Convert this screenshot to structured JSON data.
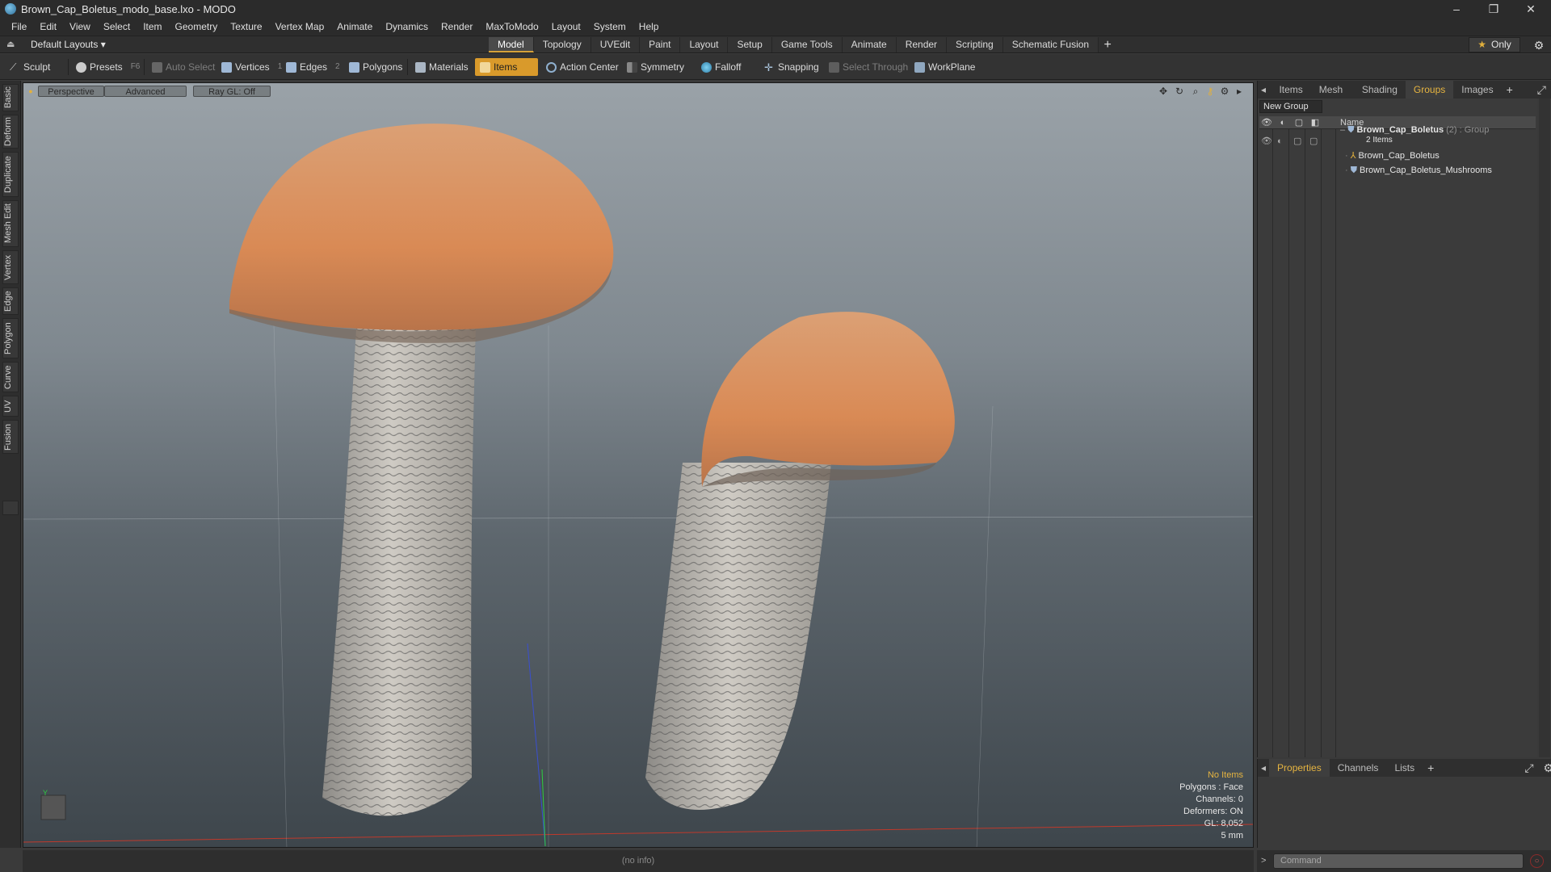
{
  "window": {
    "title": "Brown_Cap_Boletus_modo_base.lxo - MODO",
    "minimize": "–",
    "maximize": "❐",
    "close": "✕"
  },
  "menu": [
    "File",
    "Edit",
    "View",
    "Select",
    "Item",
    "Geometry",
    "Texture",
    "Vertex Map",
    "Animate",
    "Dynamics",
    "Render",
    "MaxToModo",
    "Layout",
    "System",
    "Help"
  ],
  "layout": {
    "selector": "Default Layouts ▾",
    "tabs": [
      "Model",
      "Topology",
      "UVEdit",
      "Paint",
      "Layout",
      "Setup",
      "Game Tools",
      "Animate",
      "Render",
      "Scripting",
      "Schematic Fusion"
    ],
    "active_tab": "Model",
    "add": "+",
    "only": "Only"
  },
  "toolbar": {
    "sculpt": "Sculpt",
    "presets": "Presets",
    "presets_key": "F6",
    "auto_select": "Auto Select",
    "vertices": "Vertices",
    "vertices_key": "1",
    "edges": "Edges",
    "edges_key": "2",
    "polygons": "Polygons",
    "materials": "Materials",
    "items": "Items",
    "action_center": "Action Center",
    "symmetry": "Symmetry",
    "falloff": "Falloff",
    "snapping": "Snapping",
    "select_through": "Select Through",
    "workplane": "WorkPlane"
  },
  "left_tabs": [
    "Basic",
    "Deform",
    "Duplicate",
    "Mesh Edit",
    "Vertex",
    "Edge",
    "Polygon",
    "Curve",
    "UV",
    "Fusion"
  ],
  "viewport": {
    "perspective": "Perspective",
    "advanced": "Advanced",
    "raygl": "Ray GL: Off",
    "axis_y": "Y",
    "info": {
      "no_items": "No Items",
      "polygons": "Polygons : Face",
      "channels": "Channels: 0",
      "deformers": "Deformers: ON",
      "gl": "GL: 8,052",
      "scale": "5 mm"
    }
  },
  "status": "(no info)",
  "right_panel": {
    "tabs": [
      "Items",
      "Mesh Ops",
      "Shading",
      "Groups",
      "Images"
    ],
    "active_tab": "Groups",
    "add": "+",
    "new_group": "New Group",
    "name_header": "Name",
    "group": {
      "name": "Brown_Cap_Boletus",
      "count": "(2)",
      "type": ": Group",
      "items_label": "2 Items",
      "children": [
        "Brown_Cap_Boletus",
        "Brown_Cap_Boletus_Mushrooms"
      ]
    }
  },
  "bottom_panel": {
    "tabs": [
      "Properties",
      "Channels",
      "Lists"
    ],
    "active_tab": "Properties",
    "add": "+"
  },
  "command": {
    "prompt": ">",
    "placeholder": "Command"
  },
  "colors": {
    "accent": "#d99a2b",
    "cap": "#d98a55",
    "stem": "#b8b4ad"
  }
}
